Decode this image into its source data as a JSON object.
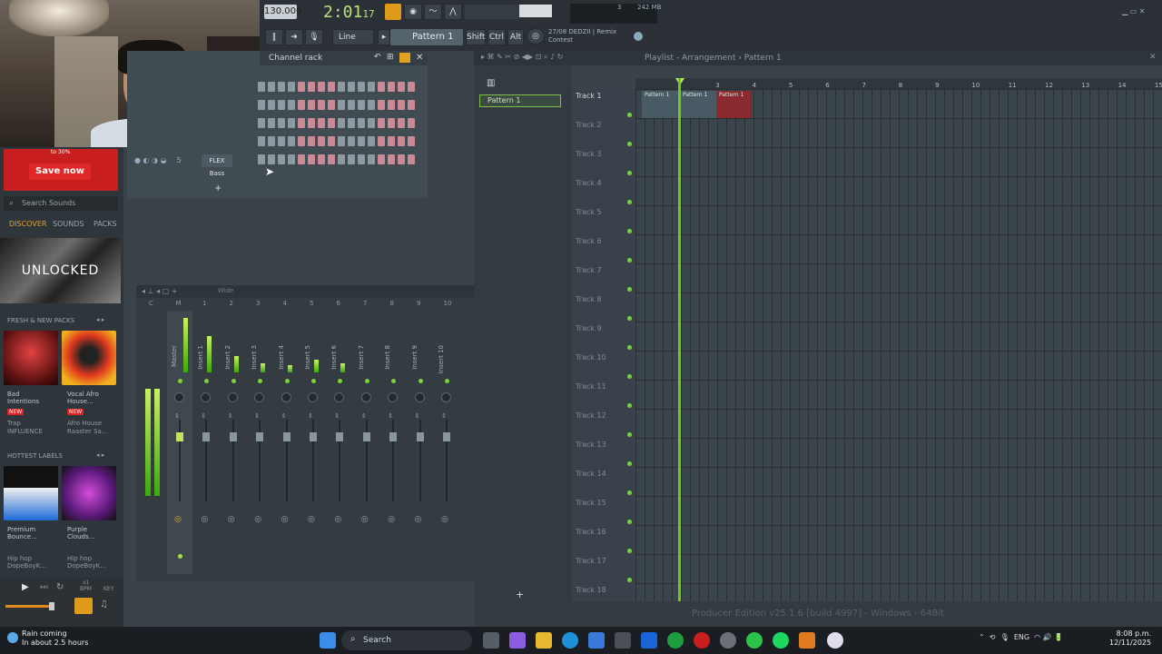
{
  "topbar": {
    "tempo": "130.000",
    "time": "2:01",
    "time_small": "17",
    "pattern": "Pattern 1",
    "snap": "Line",
    "song_line1": "27/08  DEDZII | Remix",
    "song_line2": "Contest",
    "mem": "242 MB",
    "cpu_small": "3",
    "shift_label": "Shift",
    "ctrl_label": "Ctrl",
    "alt_label": "Alt"
  },
  "browser": {
    "ad_text": "to 30%",
    "save_button": "Save now",
    "search_placeholder": "Search Sounds",
    "tabs": [
      "DISCOVER",
      "SOUNDS",
      "PACKS"
    ],
    "banner": "UNLOCKED",
    "section_fresh": "FRESH & NEW PACKS",
    "packs": [
      {
        "title1": "Bad",
        "title2": "Intentions",
        "badge": "NEW",
        "genre": "Trap",
        "label": "INFLUENCE"
      },
      {
        "title1": "Vocal Afro",
        "title2": "House...",
        "badge": "NEW",
        "genre": "Afro House",
        "label": "Raaster Sa..."
      }
    ],
    "section_labels": "HOTTEST LABELS",
    "labels": [
      {
        "title1": "Premium",
        "title2": "Bounce...",
        "genre": "Hip hop",
        "label": "DopeBoyK..."
      },
      {
        "title1": "Purple",
        "title2": "Clouds...",
        "genre": "Hip hop",
        "label": "DopeBoyK..."
      }
    ],
    "bpm_label": "BPM",
    "key_label": "KEY",
    "bpm_value": "x1"
  },
  "channel_rack": {
    "title": "Channel rack",
    "channel_number": "5",
    "channel_name": "FLEX Bass"
  },
  "mixer": {
    "preset": "Wide",
    "master": "Master",
    "inserts": [
      "Insert 1",
      "Insert 2",
      "Insert 3",
      "Insert 4",
      "Insert 5",
      "Insert 6",
      "Insert 7",
      "Insert 8",
      "Insert 9",
      "Insert 10"
    ],
    "numbers": [
      "C",
      "M",
      "1",
      "2",
      "3",
      "4",
      "5",
      "6",
      "7",
      "8",
      "9",
      "10"
    ]
  },
  "playlist": {
    "title": "Playlist - Arrangement",
    "breadcrumb": "Pattern 1",
    "picker_item": "Pattern 1",
    "tracks": [
      "Track 1",
      "Track 2",
      "Track 3",
      "Track 4",
      "Track 5",
      "Track 6",
      "Track 7",
      "Track 8",
      "Track 9",
      "Track 10",
      "Track 11",
      "Track 12",
      "Track 13",
      "Track 14",
      "Track 15",
      "Track 16",
      "Track 17",
      "Track 18"
    ],
    "ruler": [
      "2",
      "3",
      "4",
      "5",
      "6",
      "7",
      "8",
      "9",
      "10",
      "11",
      "12",
      "13",
      "14",
      "15"
    ],
    "clips": [
      "Pattern 1",
      "Pattern 1",
      "Pattern 1"
    ],
    "status": "Producer Edition v25.1.6 [build 4997] - Windows - 64Bit"
  },
  "taskbar": {
    "weather_title": "Rain coming",
    "weather_sub": "In about 2.5 hours",
    "search": "Search",
    "lang": "ENG",
    "time": "8:08 p.m.",
    "date": "12/11/2025"
  }
}
